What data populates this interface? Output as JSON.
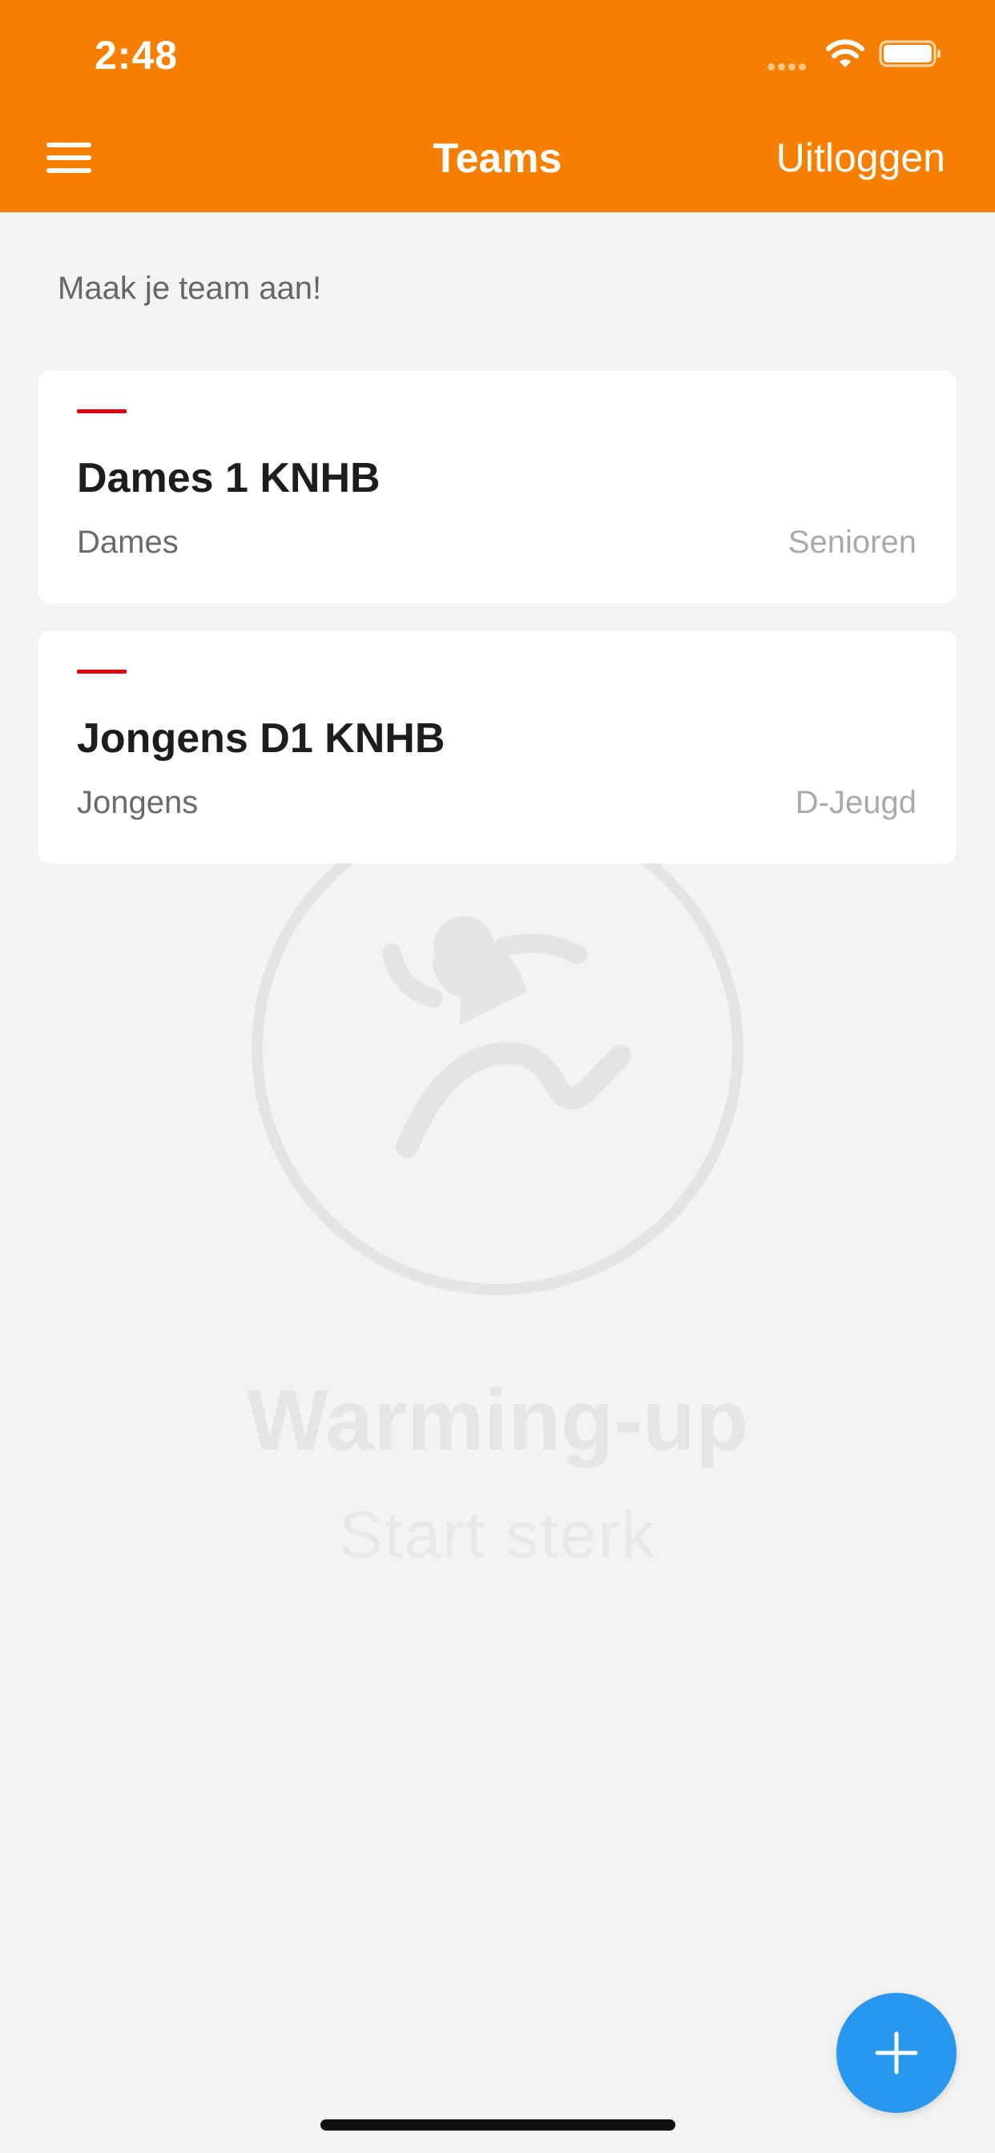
{
  "status_bar": {
    "time": "2:48"
  },
  "header": {
    "title": "Teams",
    "logout_label": "Uitloggen",
    "menu_icon": "hamburger-icon"
  },
  "intro": {
    "text": "Maak je team aan!"
  },
  "teams": [
    {
      "name": "Dames 1 KNHB",
      "gender": "Dames",
      "category": "Senioren"
    },
    {
      "name": "Jongens D1 KNHB",
      "gender": "Jongens",
      "category": "D-Jeugd"
    }
  ],
  "empty_state": {
    "title": "Warming-up",
    "subtitle": "Start sterk",
    "icon": "running-person-icon"
  },
  "fab": {
    "icon": "plus-icon"
  },
  "colors": {
    "header": "#f77f00",
    "accent_line": "#e0000f",
    "fab": "#2897ee",
    "background": "#f3f3f3"
  }
}
